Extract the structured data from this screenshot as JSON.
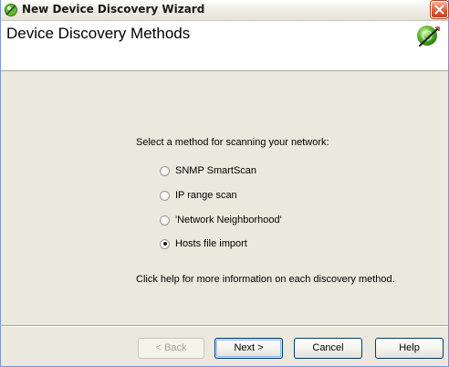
{
  "window": {
    "title": "New Device Discovery Wizard"
  },
  "header": {
    "title": "Device Discovery Methods",
    "logo_icon": "green-globe-icon"
  },
  "main": {
    "prompt": "Select a method for scanning your network:",
    "options": [
      {
        "label": "SNMP SmartScan",
        "selected": false
      },
      {
        "label": "IP range scan",
        "selected": false
      },
      {
        "label": "'Network Neighborhood'",
        "selected": false
      },
      {
        "label": "Hosts file import",
        "selected": true
      }
    ],
    "help_text": "Click help for more information on each discovery method."
  },
  "buttons": {
    "back": "< Back",
    "next": "Next >",
    "cancel": "Cancel",
    "help": "Help"
  },
  "colors": {
    "window_border": "#7a96df",
    "dialog_face": "#ebe9de",
    "close_button": "#e0623f",
    "logo_green": "#5fb832"
  }
}
